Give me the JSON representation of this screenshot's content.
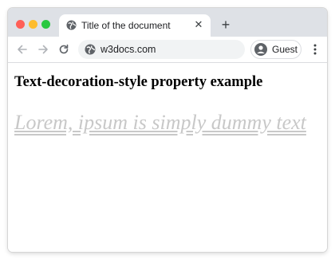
{
  "browser": {
    "tab": {
      "title": "Title of the document",
      "close_icon": "close-icon",
      "favicon_icon": "globe-icon"
    },
    "new_tab_icon": "plus-icon",
    "toolbar": {
      "back_icon": "arrow-left-icon",
      "forward_icon": "arrow-right-icon",
      "reload_icon": "reload-icon",
      "url": "w3docs.com",
      "profile_label": "Guest",
      "menu_icon": "kebab-menu-icon"
    },
    "colors": {
      "traffic_close": "#ff5f57",
      "traffic_minimize": "#febc2e",
      "traffic_maximize": "#28c840",
      "titlebar_bg": "#dee1e6",
      "omnibox_bg": "#f1f3f4"
    }
  },
  "page": {
    "heading": "Text-decoration-style property example",
    "styled_text": "Lorem, ipsum is simply dummy text",
    "styled_text_color": "#c8c8c8"
  }
}
